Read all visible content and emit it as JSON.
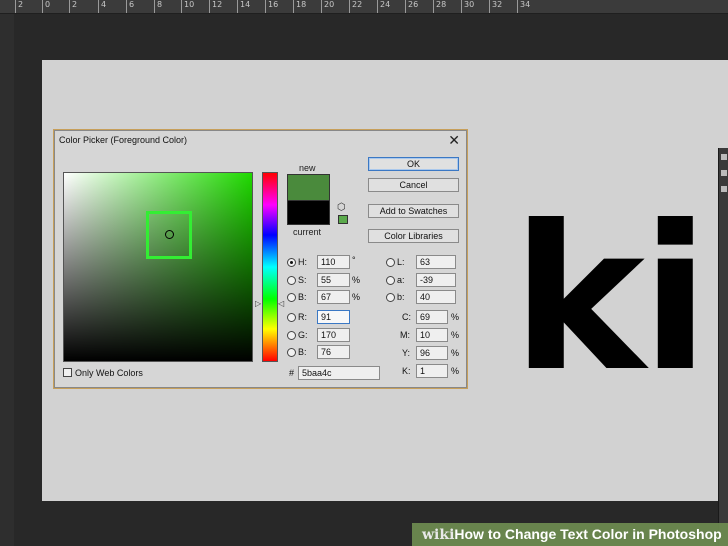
{
  "ruler": {
    "ticks": [
      "2",
      "0",
      "2",
      "4",
      "6",
      "8",
      "10",
      "12",
      "14",
      "16",
      "18",
      "20",
      "22",
      "24",
      "26",
      "28",
      "30",
      "32",
      "34"
    ]
  },
  "canvas_text": "ki",
  "dialog": {
    "title": "Color Picker (Foreground Color)",
    "close_glyph": "✕",
    "new_label": "new",
    "current_label": "current",
    "new_color": "#4a8a3c",
    "current_color": "#000000",
    "buttons": {
      "ok": "OK",
      "cancel": "Cancel",
      "add_swatches": "Add to Swatches",
      "color_libraries": "Color Libraries"
    },
    "hsb": {
      "h": {
        "label": "H:",
        "value": "110",
        "unit": "°",
        "selected": true
      },
      "s": {
        "label": "S:",
        "value": "55",
        "unit": "%"
      },
      "b": {
        "label": "B:",
        "value": "67",
        "unit": "%"
      }
    },
    "rgb": {
      "r": {
        "label": "R:",
        "value": "91"
      },
      "g": {
        "label": "G:",
        "value": "170"
      },
      "b": {
        "label": "B:",
        "value": "76"
      }
    },
    "lab": {
      "l": {
        "label": "L:",
        "value": "63"
      },
      "a": {
        "label": "a:",
        "value": "-39"
      },
      "b": {
        "label": "b:",
        "value": "40"
      }
    },
    "cmyk": {
      "c": {
        "label": "C:",
        "value": "69",
        "unit": "%"
      },
      "m": {
        "label": "M:",
        "value": "10",
        "unit": "%"
      },
      "y": {
        "label": "Y:",
        "value": "96",
        "unit": "%"
      },
      "k": {
        "label": "K:",
        "value": "1",
        "unit": "%"
      }
    },
    "hex_label": "#",
    "hex_value": "5baa4c",
    "only_web_colors": "Only Web Colors",
    "icons": {
      "cube": "cube-icon"
    }
  },
  "banner": {
    "brand": "wiki",
    "title": "How to Change Text Color in Photoshop"
  }
}
